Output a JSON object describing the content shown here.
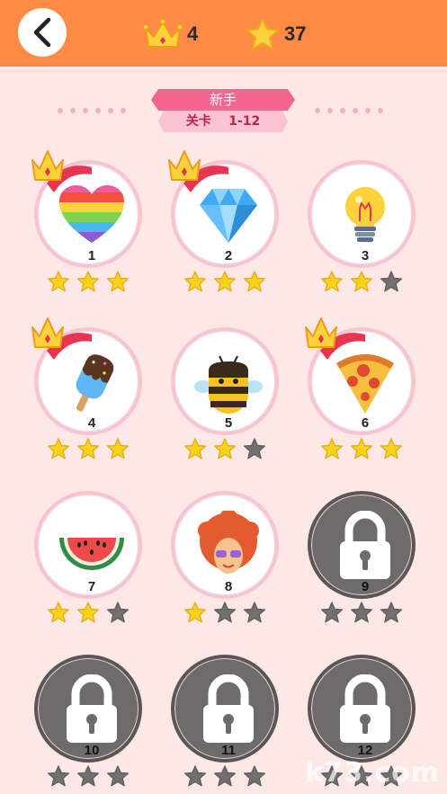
{
  "header": {
    "crown_count": "4",
    "star_count": "37"
  },
  "banner": {
    "mode": "新手",
    "level_label": "关卡",
    "range": "1-12"
  },
  "levels": [
    {
      "number": "1",
      "icon": "rainbow-heart-icon",
      "stars_earned": 3,
      "crowned": true,
      "locked": false
    },
    {
      "number": "2",
      "icon": "diamond-icon",
      "stars_earned": 3,
      "crowned": true,
      "locked": false
    },
    {
      "number": "3",
      "icon": "lightbulb-icon",
      "stars_earned": 2,
      "crowned": false,
      "locked": false
    },
    {
      "number": "4",
      "icon": "ice-cream-bar-icon",
      "stars_earned": 3,
      "crowned": true,
      "locked": false
    },
    {
      "number": "5",
      "icon": "bee-icon",
      "stars_earned": 2,
      "crowned": false,
      "locked": false
    },
    {
      "number": "6",
      "icon": "pizza-slice-icon",
      "stars_earned": 3,
      "crowned": true,
      "locked": false
    },
    {
      "number": "7",
      "icon": "watermelon-slice-icon",
      "stars_earned": 2,
      "crowned": false,
      "locked": false
    },
    {
      "number": "8",
      "icon": "afro-face-icon",
      "stars_earned": 1,
      "crowned": false,
      "locked": false
    },
    {
      "number": "9",
      "icon": "padlock-icon",
      "stars_earned": 0,
      "crowned": false,
      "locked": true
    },
    {
      "number": "10",
      "icon": "padlock-icon",
      "stars_earned": 0,
      "crowned": false,
      "locked": true
    },
    {
      "number": "11",
      "icon": "padlock-icon",
      "stars_earned": 0,
      "crowned": false,
      "locked": true
    },
    {
      "number": "12",
      "icon": "padlock-icon",
      "stars_earned": 0,
      "crowned": false,
      "locked": true
    }
  ],
  "watermark": "k73.com",
  "colors": {
    "topbar": "#fe8b45",
    "background": "#fde8e6",
    "star_gold": "#f7d21b",
    "star_gray": "#707070",
    "banner_pink": "#f3668f"
  }
}
